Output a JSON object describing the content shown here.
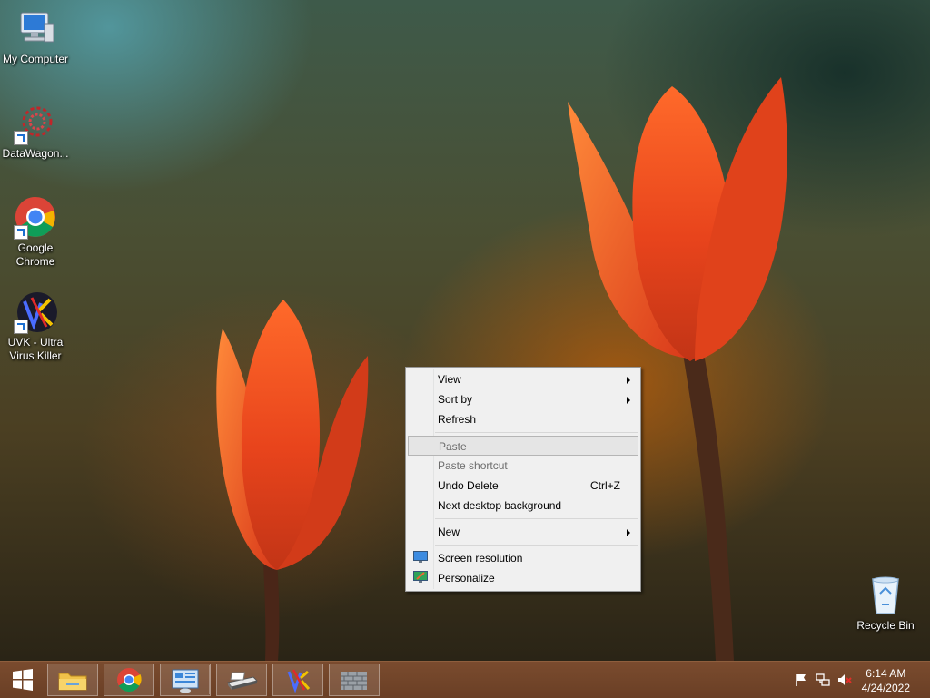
{
  "desktop": {
    "icons": [
      {
        "label": "My Computer",
        "icon": "computer-icon"
      },
      {
        "label": "DataWagon...",
        "icon": "datawagon-icon"
      },
      {
        "label": "Google Chrome",
        "icon": "chrome-icon"
      },
      {
        "label": "UVK - Ultra Virus Killer",
        "icon": "uvk-icon"
      }
    ],
    "recycle_bin": {
      "label": "Recycle Bin",
      "icon": "recycle-bin-icon"
    }
  },
  "context_menu": {
    "items": {
      "view": "View",
      "sort_by": "Sort by",
      "refresh": "Refresh",
      "paste": "Paste",
      "paste_shortcut": "Paste shortcut",
      "undo_delete": "Undo Delete",
      "undo_delete_accel": "Ctrl+Z",
      "next_background": "Next desktop background",
      "new": "New",
      "screen_resolution": "Screen resolution",
      "personalize": "Personalize"
    },
    "colors": {
      "background": "#f0f0f0",
      "disabled_text": "#6d6d6d",
      "hover": "#e5e5e5"
    }
  },
  "taskbar": {
    "pinned": [
      {
        "icon": "windows-start-icon"
      },
      {
        "icon": "file-explorer-icon"
      },
      {
        "icon": "chrome-icon"
      },
      {
        "icon": "control-panel-icon"
      },
      {
        "icon": "scanner-icon"
      },
      {
        "icon": "uvk-icon"
      },
      {
        "icon": "firewall-icon"
      }
    ],
    "tray": {
      "icons": [
        "flag-icon",
        "network-icon",
        "volume-muted-icon"
      ],
      "time": "6:14 AM",
      "date": "4/24/2022"
    },
    "color": "#6e4228"
  }
}
